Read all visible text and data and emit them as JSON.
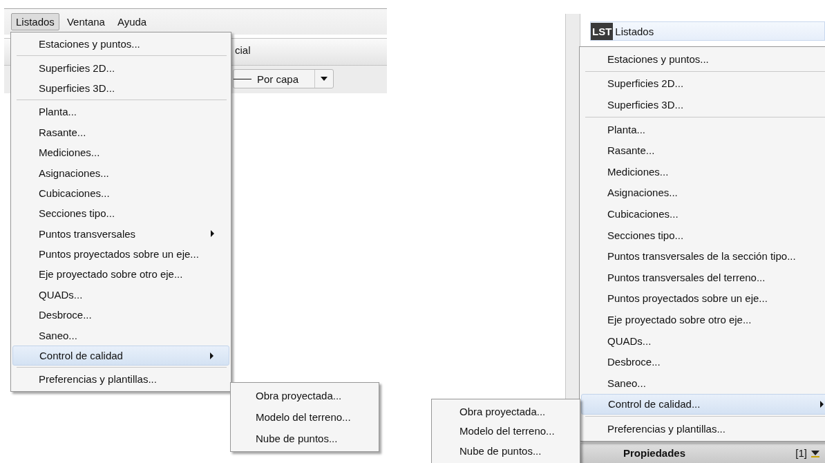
{
  "left_window": {
    "menu_bar": [
      {
        "label": "Listados",
        "selected": true
      },
      {
        "label": "Ventana",
        "selected": false
      },
      {
        "label": "Ayuda",
        "selected": false
      }
    ],
    "tab_label": "cial",
    "line_style": "Por capa",
    "menu": {
      "groups": [
        [
          {
            "label": "Estaciones y puntos...",
            "submenu": false,
            "selected": false
          }
        ],
        [
          {
            "label": "Superficies 2D...",
            "submenu": false,
            "selected": false
          },
          {
            "label": "Superficies 3D...",
            "submenu": false,
            "selected": false
          }
        ],
        [
          {
            "label": "Planta...",
            "submenu": false,
            "selected": false
          },
          {
            "label": "Rasante...",
            "submenu": false,
            "selected": false
          },
          {
            "label": "Mediciones...",
            "submenu": false,
            "selected": false
          },
          {
            "label": "Asignaciones...",
            "submenu": false,
            "selected": false
          },
          {
            "label": "Cubicaciones...",
            "submenu": false,
            "selected": false
          },
          {
            "label": "Secciones tipo...",
            "submenu": false,
            "selected": false
          },
          {
            "label": "Puntos transversales",
            "submenu": true,
            "selected": false
          },
          {
            "label": "Puntos proyectados sobre un eje...",
            "submenu": false,
            "selected": false
          },
          {
            "label": "Eje proyectado sobre otro eje...",
            "submenu": false,
            "selected": false
          },
          {
            "label": "QUADs...",
            "submenu": false,
            "selected": false
          },
          {
            "label": "Desbroce...",
            "submenu": false,
            "selected": false
          },
          {
            "label": "Saneo...",
            "submenu": false,
            "selected": false
          },
          {
            "label": "Control de calidad",
            "submenu": true,
            "selected": true
          }
        ],
        [
          {
            "label": "Preferencias y plantillas...",
            "submenu": false,
            "selected": false
          }
        ]
      ]
    },
    "submenu": [
      {
        "label": "Obra proyectada...",
        "selected": false
      },
      {
        "label": "Modelo del terreno...",
        "selected": false
      },
      {
        "label": "Nube de puntos...",
        "selected": false
      }
    ]
  },
  "right_window": {
    "tab": {
      "icon_label": "LST",
      "label": "Listados"
    },
    "menu": {
      "groups": [
        [
          {
            "label": "Estaciones y puntos...",
            "submenu": false,
            "selected": false
          }
        ],
        [
          {
            "label": "Superficies 2D...",
            "submenu": false,
            "selected": false
          },
          {
            "label": "Superficies 3D...",
            "submenu": false,
            "selected": false
          }
        ],
        [
          {
            "label": "Planta...",
            "submenu": false,
            "selected": false
          },
          {
            "label": "Rasante...",
            "submenu": false,
            "selected": false
          },
          {
            "label": "Mediciones...",
            "submenu": false,
            "selected": false
          },
          {
            "label": "Asignaciones...",
            "submenu": false,
            "selected": false
          },
          {
            "label": "Cubicaciones...",
            "submenu": false,
            "selected": false
          },
          {
            "label": "Secciones tipo...",
            "submenu": false,
            "selected": false
          },
          {
            "label": "Puntos transversales de la sección tipo...",
            "submenu": false,
            "selected": false
          },
          {
            "label": "Puntos transversales del terreno...",
            "submenu": false,
            "selected": false
          },
          {
            "label": "Puntos proyectados sobre un eje...",
            "submenu": false,
            "selected": false
          },
          {
            "label": "Eje proyectado sobre otro eje...",
            "submenu": false,
            "selected": false
          },
          {
            "label": "QUADs...",
            "submenu": false,
            "selected": false
          },
          {
            "label": "Desbroce...",
            "submenu": false,
            "selected": false
          },
          {
            "label": "Saneo...",
            "submenu": false,
            "selected": false
          },
          {
            "label": "Control de calidad...",
            "submenu": true,
            "selected": true
          }
        ],
        [
          {
            "label": "Preferencias y plantillas...",
            "submenu": false,
            "selected": false
          }
        ]
      ]
    },
    "submenu": [
      {
        "label": "Obra proyectada...",
        "selected": false
      },
      {
        "label": "Modelo del terreno...",
        "selected": false
      },
      {
        "label": "Nube de puntos...",
        "selected": false
      }
    ],
    "panel_title": "Propiedades",
    "panel_count": "[1]"
  }
}
